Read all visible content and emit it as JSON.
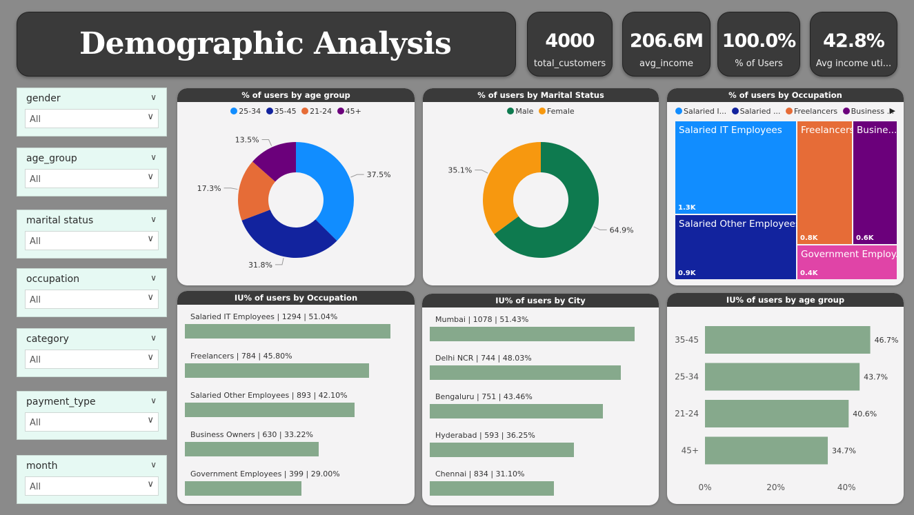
{
  "title": "Demographic Analysis",
  "kpis": [
    {
      "value": "4000",
      "label": "total_customers"
    },
    {
      "value": "206.6M",
      "label": "avg_income"
    },
    {
      "value": "100.0%",
      "label": "% of Users"
    },
    {
      "value": "42.8%",
      "label": "Avg income uti..."
    }
  ],
  "slicers": [
    {
      "title": "gender",
      "value": "All"
    },
    {
      "title": "age_group",
      "value": "All"
    },
    {
      "title": "marital status",
      "value": "All"
    },
    {
      "title": "occupation",
      "value": "All"
    },
    {
      "title": "category",
      "value": "All"
    },
    {
      "title": "payment_type",
      "value": "All"
    },
    {
      "title": "month",
      "value": "All"
    }
  ],
  "colors": {
    "age_25_34": "#118dff",
    "age_35_45": "#12239e",
    "age_21_24": "#e66c37",
    "age_45_plus": "#6b007b",
    "male": "#0e7a4f",
    "female": "#f7980f",
    "bar": "#86a98c",
    "gov": "#e044a7"
  },
  "chart_data": [
    {
      "type": "pie",
      "title": "% of users by age group",
      "categories": [
        "25-34",
        "35-45",
        "21-24",
        "45+"
      ],
      "values": [
        37.5,
        31.8,
        17.3,
        13.5
      ],
      "value_labels": [
        "37.5%",
        "31.8%",
        "17.3%",
        "13.5%"
      ]
    },
    {
      "type": "pie",
      "title": "% of users by Marital Status",
      "categories": [
        "Male",
        "Female"
      ],
      "values": [
        64.9,
        35.1
      ],
      "value_labels": [
        "64.9%",
        "35.1%"
      ]
    },
    {
      "type": "treemap",
      "title": "% of users by Occupation",
      "legend": [
        "Salaried I...",
        "Salaried ...",
        "Freelancers",
        "Business ..."
      ],
      "categories": [
        "Salaried IT Employees",
        "Salaried Other Employees",
        "Freelancers",
        "Busine...",
        "Government Employ..."
      ],
      "values": [
        1.3,
        0.9,
        0.8,
        0.6,
        0.4
      ],
      "value_labels": [
        "1.3K",
        "0.9K",
        "0.8K",
        "0.6K",
        "0.4K"
      ]
    },
    {
      "type": "bar",
      "title": "IU% of users by Occupation",
      "categories": [
        "Salaried IT Employees | 1294 | 51.04%",
        "Freelancers | 784 | 45.80%",
        "Salaried Other Employees | 893 | 42.10%",
        "Business Owners | 630 | 33.22%",
        "Government Employees | 399 | 29.00%"
      ],
      "values": [
        51.04,
        45.8,
        42.1,
        33.22,
        29.0
      ]
    },
    {
      "type": "bar",
      "title": "IU% of users by City",
      "categories": [
        "Mumbai | 1078 | 51.43%",
        "Delhi NCR | 744 | 48.03%",
        "Bengaluru | 751 | 43.46%",
        "Hyderabad | 593 | 36.25%",
        "Chennai | 834 | 31.10%"
      ],
      "values": [
        51.43,
        48.03,
        43.46,
        36.25,
        31.1
      ]
    },
    {
      "type": "bar",
      "title": "IU% of users by age group",
      "categories": [
        "35-45",
        "25-34",
        "21-24",
        "45+"
      ],
      "values": [
        46.7,
        43.7,
        40.6,
        34.7
      ],
      "value_labels": [
        "46.7%",
        "43.7%",
        "40.6%",
        "34.7%"
      ],
      "xticks": [
        "0%",
        "20%",
        "40%"
      ],
      "xlim": [
        0,
        0.5
      ]
    }
  ]
}
